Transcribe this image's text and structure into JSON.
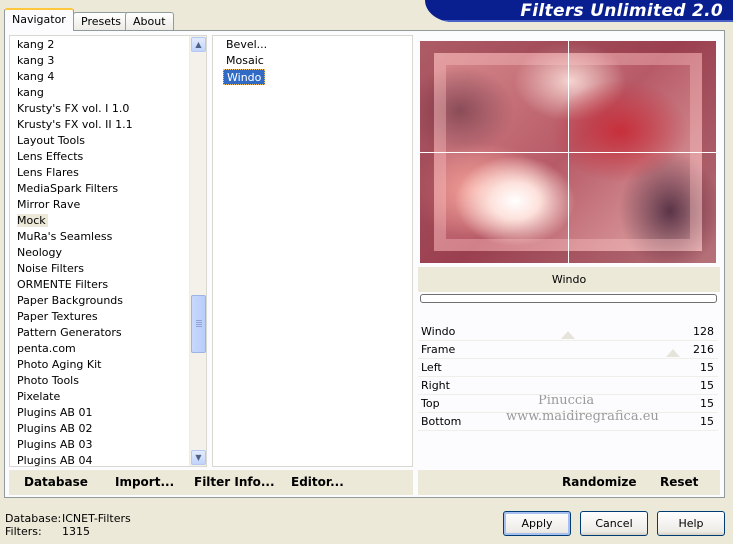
{
  "tabs": [
    "Navigator",
    "Presets",
    "About"
  ],
  "active_tab": "Navigator",
  "banner_title": "Filters Unlimited 2.0",
  "categories": [
    "kang 2",
    "kang 3",
    "kang 4",
    "kang",
    "Krusty's FX vol. I 1.0",
    "Krusty's FX vol. II 1.1",
    "Layout Tools",
    "Lens Effects",
    "Lens Flares",
    "MediaSpark Filters",
    "Mirror Rave",
    "Mock",
    "MuRa's Seamless",
    "Neology",
    "Noise Filters",
    "ORMENTE Filters",
    "Paper Backgrounds",
    "Paper Textures",
    "Pattern Generators",
    "penta.com",
    "Photo Aging Kit",
    "Photo Tools",
    "Pixelate",
    "Plugins AB 01",
    "Plugins AB 02",
    "Plugins AB 03",
    "Plugins AB 04"
  ],
  "selected_category": "Mock",
  "filters": [
    "Bevel...",
    "Mosaic",
    "Windo"
  ],
  "selected_filter": "Windo",
  "preview_filter_name": "Windo",
  "params": [
    {
      "name": "Windo",
      "value": "128",
      "level": 0.5
    },
    {
      "name": "Frame",
      "value": "216",
      "level": 0.85
    },
    {
      "name": "Left",
      "value": "15",
      "level": 0.06
    },
    {
      "name": "Right",
      "value": "15",
      "level": 0.06
    },
    {
      "name": "Top",
      "value": "15",
      "level": 0.06
    },
    {
      "name": "Bottom",
      "value": "15",
      "level": 0.06
    }
  ],
  "watermark": [
    "Pinuccia",
    "www.maidiregrafica.eu"
  ],
  "toolbar": {
    "database": "Database",
    "import": "Import...",
    "filter_info": "Filter Info...",
    "editor": "Editor...",
    "randomize": "Randomize",
    "reset": "Reset"
  },
  "status": {
    "database_label": "Database:",
    "database_value": "ICNET-Filters",
    "filters_label": "Filters:",
    "filters_value": "1315"
  },
  "buttons": {
    "apply": "Apply",
    "cancel": "Cancel",
    "help": "Help"
  },
  "icons": {
    "scroll_up": "arrow-up-icon",
    "scroll_down": "arrow-down-icon"
  },
  "colors": {
    "banner": "#0a1f8f",
    "selection": "#316ac5",
    "dialog_bg": "#ece9d8"
  }
}
